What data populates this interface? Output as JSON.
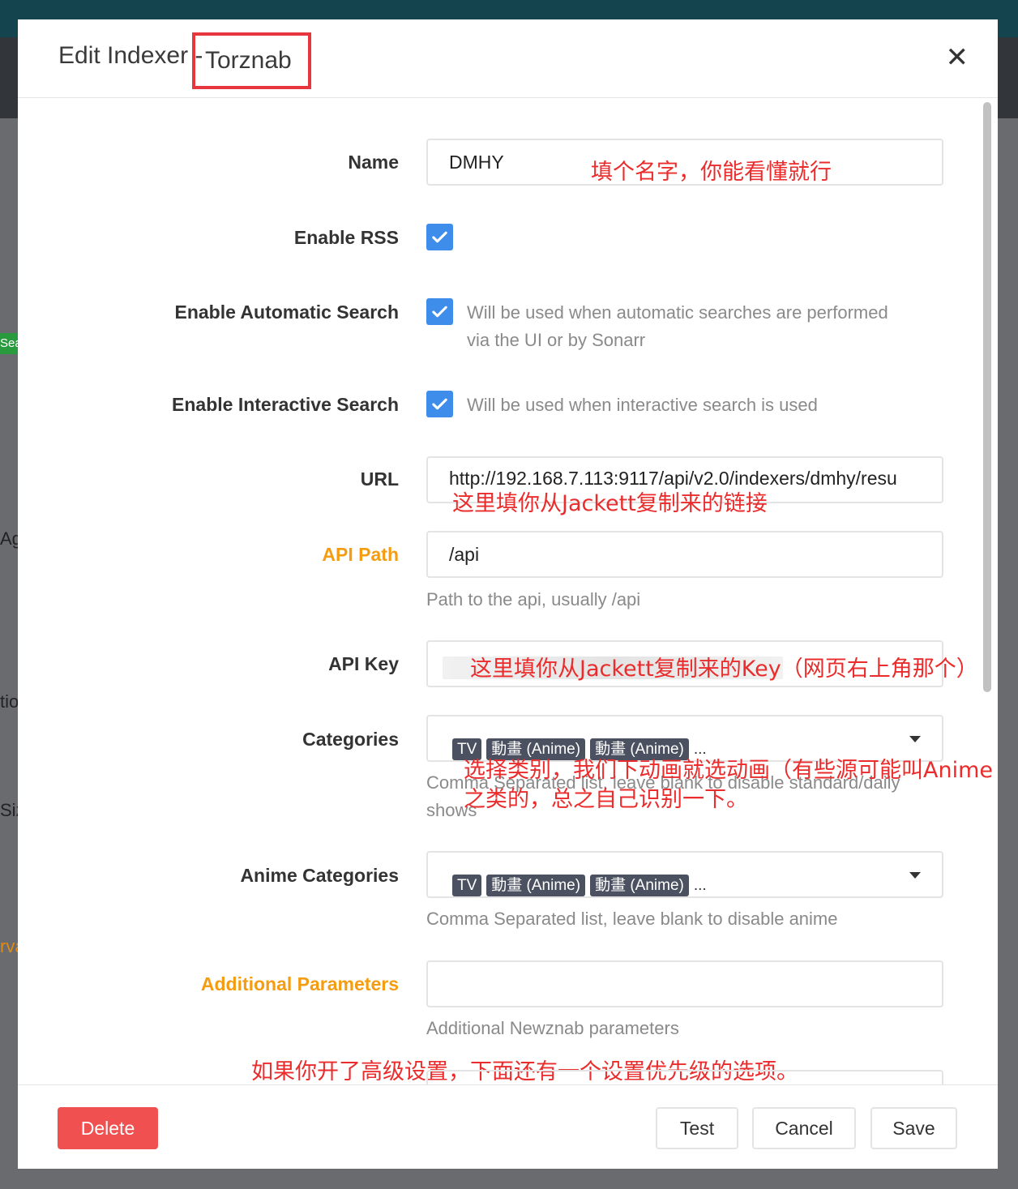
{
  "background": {
    "fragments": [
      "Sea",
      "Ag",
      "tio",
      "Siz",
      "rva"
    ]
  },
  "modal": {
    "title": "Edit Indexer -",
    "indexer_type": "Torznab"
  },
  "fields": {
    "name": {
      "label": "Name",
      "value": "DMHY"
    },
    "enable_rss": {
      "label": "Enable RSS",
      "checked": true
    },
    "enable_auto_search": {
      "label": "Enable Automatic Search",
      "checked": true,
      "help_line1": "Will be used when automatic searches are performed",
      "help_line2": "via the UI or by Sonarr"
    },
    "enable_interactive_search": {
      "label": "Enable Interactive Search",
      "checked": true,
      "help": "Will be used when interactive search is used"
    },
    "url": {
      "label": "URL",
      "value": "http://192.168.7.113:9117/api/v2.0/indexers/dmhy/resu"
    },
    "api_path": {
      "label": "API Path",
      "value": "/api",
      "hint": "Path to the api, usually /api"
    },
    "api_key": {
      "label": "API Key"
    },
    "categories": {
      "label": "Categories",
      "tags": [
        "TV",
        "動畫 (Anime)",
        "動畫 (Anime)"
      ],
      "more": "...",
      "hint_line1": "Comma Separated list, leave blank to disable standard/daily",
      "hint_line2": "shows"
    },
    "anime_categories": {
      "label": "Anime Categories",
      "tags": [
        "TV",
        "動畫 (Anime)",
        "動畫 (Anime)"
      ],
      "more": "...",
      "hint": "Comma Separated list, leave blank to disable anime"
    },
    "additional_params": {
      "label": "Additional Parameters",
      "value": "",
      "hint": "Additional Newznab parameters"
    }
  },
  "annotations": {
    "name_note": "填个名字，你能看懂就行",
    "url_note": "这里填你从Jackett复制来的链接",
    "key_note": "这里填你从Jackett复制来的Key（网页右上角那个）",
    "cat_note_line1": "选择类别，我们下动画就选动画（有些源可能叫Anime",
    "cat_note_line2": "之类的，总之自己识别一下。",
    "adv_note": "如果你开了高级设置，下面还有一个设置优先级的选项。"
  },
  "footer": {
    "delete": "Delete",
    "test": "Test",
    "cancel": "Cancel",
    "save": "Save"
  },
  "colors": {
    "accent_checkbox": "#3f8dea",
    "delete_button": "#f05050",
    "advanced_label": "#f49d12",
    "annotation": "#ea2c2c",
    "highlight_box": "#e8363f"
  }
}
